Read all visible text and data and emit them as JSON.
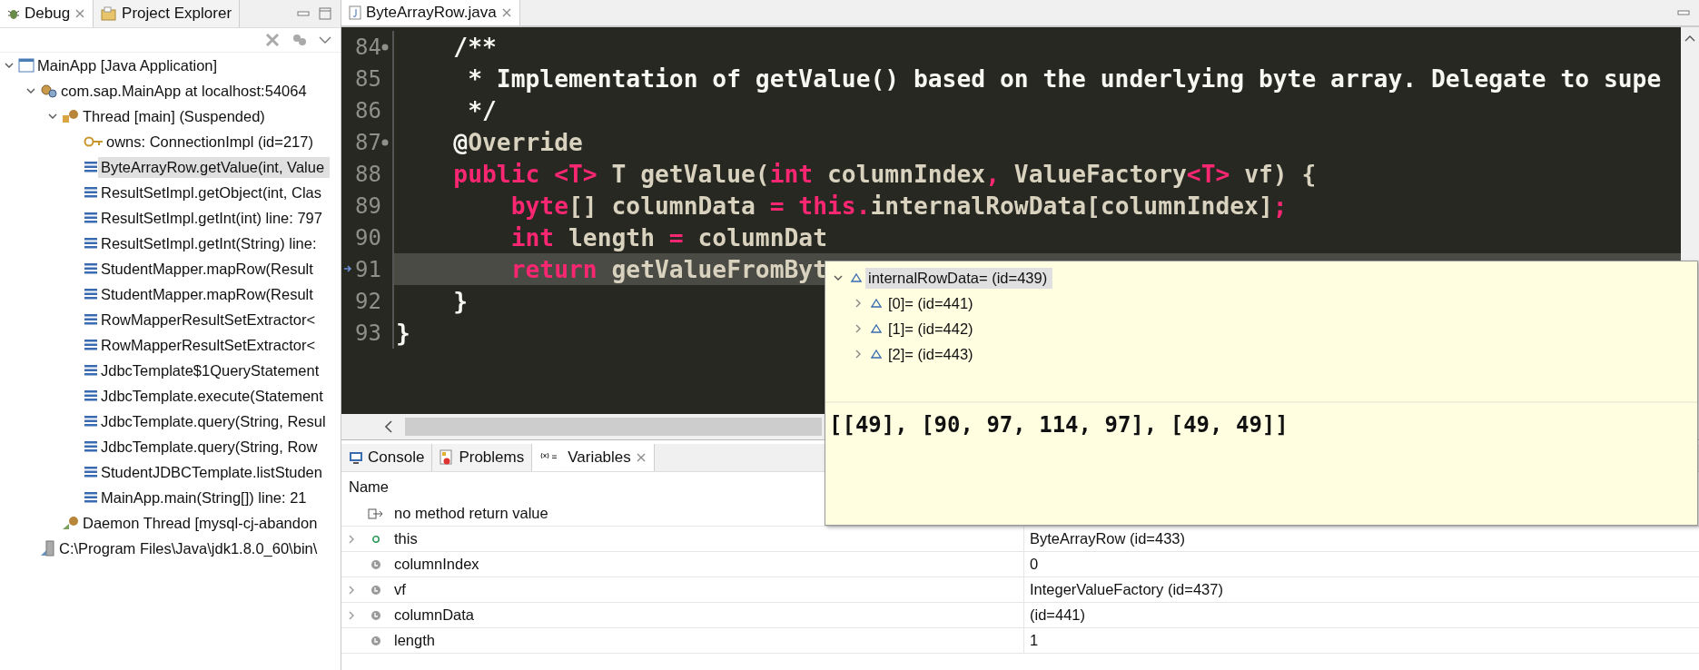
{
  "debug_view": {
    "tabs": [
      {
        "label": "Debug",
        "selected": true,
        "kind": "debug"
      },
      {
        "label": "Project Explorer",
        "selected": false,
        "kind": "explorer"
      }
    ],
    "tree": [
      {
        "label": "MainApp [Java Application]",
        "kind": "app",
        "expanded": true,
        "selected": false,
        "children": [
          {
            "label": "com.sap.MainApp at localhost:54064",
            "kind": "process",
            "expanded": true,
            "selected": false,
            "children": [
              {
                "label": "Thread [main] (Suspended)",
                "kind": "thread",
                "expanded": true,
                "selected": false,
                "children": [
                  {
                    "label": "owns: ConnectionImpl  (id=217)",
                    "kind": "monitor",
                    "selected": false
                  },
                  {
                    "label": "ByteArrayRow.getValue(int, Value",
                    "kind": "frame",
                    "selected": true
                  },
                  {
                    "label": "ResultSetImpl.getObject(int, Clas",
                    "kind": "frame",
                    "selected": false
                  },
                  {
                    "label": "ResultSetImpl.getInt(int) line: 797",
                    "kind": "frame",
                    "selected": false
                  },
                  {
                    "label": "ResultSetImpl.getInt(String) line:",
                    "kind": "frame",
                    "selected": false
                  },
                  {
                    "label": "StudentMapper.mapRow(Result",
                    "kind": "frame",
                    "selected": false
                  },
                  {
                    "label": "StudentMapper.mapRow(Result",
                    "kind": "frame",
                    "selected": false
                  },
                  {
                    "label": "RowMapperResultSetExtractor<",
                    "kind": "frame",
                    "selected": false
                  },
                  {
                    "label": "RowMapperResultSetExtractor<",
                    "kind": "frame",
                    "selected": false
                  },
                  {
                    "label": "JdbcTemplate$1QueryStatement",
                    "kind": "frame",
                    "selected": false
                  },
                  {
                    "label": "JdbcTemplate.execute(Statement",
                    "kind": "frame",
                    "selected": false
                  },
                  {
                    "label": "JdbcTemplate.query(String, Resul",
                    "kind": "frame",
                    "selected": false
                  },
                  {
                    "label": "JdbcTemplate.query(String, Row",
                    "kind": "frame",
                    "selected": false
                  },
                  {
                    "label": "StudentJDBCTemplate.listStuden",
                    "kind": "frame",
                    "selected": false
                  },
                  {
                    "label": "MainApp.main(String[]) line: 21",
                    "kind": "frame",
                    "selected": false
                  }
                ]
              },
              {
                "label": "Daemon Thread [mysql-cj-abandon",
                "kind": "daemon",
                "selected": false
              }
            ]
          },
          {
            "label": "C:\\Program Files\\Java\\jdk1.8.0_60\\bin\\",
            "kind": "jvm",
            "selected": false
          }
        ]
      }
    ]
  },
  "editor": {
    "tab": {
      "label": "ByteArrayRow.java",
      "selected": true
    },
    "lines": [
      {
        "number": "84",
        "fold": true,
        "current": false,
        "tokens": [
          {
            "text": "    /**",
            "kind": "comment"
          }
        ]
      },
      {
        "number": "85",
        "fold": false,
        "current": false,
        "tokens": [
          {
            "text": "     * Implementation of getValue() based on the underlying byte array. Delegate to supe",
            "kind": "comment"
          }
        ]
      },
      {
        "number": "86",
        "fold": false,
        "current": false,
        "tokens": [
          {
            "text": "     */",
            "kind": "comment"
          }
        ]
      },
      {
        "number": "87",
        "fold": true,
        "current": false,
        "tokens": [
          {
            "text": "    @",
            "kind": "comment"
          },
          {
            "text": "Override",
            "kind": "plain"
          }
        ]
      },
      {
        "number": "88",
        "fold": false,
        "current": false,
        "tokens": [
          {
            "text": "    public <T>",
            "kind": "keyword"
          },
          {
            "text": " T getValue(",
            "kind": "plain"
          },
          {
            "text": "int",
            "kind": "keyword"
          },
          {
            "text": " columnIndex",
            "kind": "plain"
          },
          {
            "text": ",",
            "kind": "keyword"
          },
          {
            "text": " ValueFactory",
            "kind": "plain"
          },
          {
            "text": "<T>",
            "kind": "keyword"
          },
          {
            "text": " vf) {",
            "kind": "plain"
          }
        ]
      },
      {
        "number": "89",
        "fold": false,
        "current": false,
        "tokens": [
          {
            "text": "        byte",
            "kind": "keyword"
          },
          {
            "text": "[] columnData ",
            "kind": "plain"
          },
          {
            "text": "= this.",
            "kind": "keyword"
          },
          {
            "text": "internalRowData[columnIndex]",
            "kind": "plain"
          },
          {
            "text": ";",
            "kind": "keyword"
          }
        ]
      },
      {
        "number": "90",
        "fold": false,
        "current": false,
        "tokens": [
          {
            "text": "        int",
            "kind": "keyword"
          },
          {
            "text": " length ",
            "kind": "plain"
          },
          {
            "text": "=",
            "kind": "keyword"
          },
          {
            "text": " columnDat",
            "kind": "plain"
          }
        ]
      },
      {
        "number": "91",
        "fold": false,
        "current": true,
        "tokens": [
          {
            "text": "        return",
            "kind": "keyword"
          },
          {
            "text": " getValueFromByt",
            "kind": "plain"
          }
        ]
      },
      {
        "number": "92",
        "fold": false,
        "current": false,
        "tokens": [
          {
            "text": "    }",
            "kind": "comment"
          }
        ]
      },
      {
        "number": "93",
        "fold": false,
        "current": false,
        "tokens": [
          {
            "text": "}",
            "kind": "comment"
          }
        ]
      }
    ]
  },
  "inspect_popup": {
    "tree": [
      {
        "label": "internalRowData= (id=439)",
        "expanded": true,
        "selected": true,
        "children": [
          {
            "label": "[0]= (id=441)",
            "expanded": false,
            "selected": false
          },
          {
            "label": "[1]= (id=442)",
            "expanded": false,
            "selected": false
          },
          {
            "label": "[2]= (id=443)",
            "expanded": false,
            "selected": false
          }
        ]
      }
    ],
    "detail": "[[49], [90, 97, 114, 97], [49, 49]]"
  },
  "bottom_panel": {
    "tabs": [
      {
        "label": "Console",
        "selected": false,
        "kind": "console"
      },
      {
        "label": "Problems",
        "selected": false,
        "kind": "problems"
      },
      {
        "label": "Variables",
        "selected": true,
        "kind": "variables"
      }
    ],
    "columns": [
      "Name"
    ],
    "rows": [
      {
        "name": "no method return value",
        "kind": "return",
        "expandable": false
      },
      {
        "name": "this",
        "value": "ByteArrayRow  (id=433)",
        "kind": "field",
        "expandable": true
      },
      {
        "name": "columnIndex",
        "value": "0",
        "kind": "local",
        "expandable": false
      },
      {
        "name": "vf",
        "value": "IntegerValueFactory  (id=437)",
        "kind": "local",
        "expandable": true
      },
      {
        "name": "columnData",
        "value": "(id=441)",
        "kind": "local",
        "expandable": true
      },
      {
        "name": "length",
        "value": "1",
        "kind": "local",
        "expandable": false
      }
    ]
  }
}
